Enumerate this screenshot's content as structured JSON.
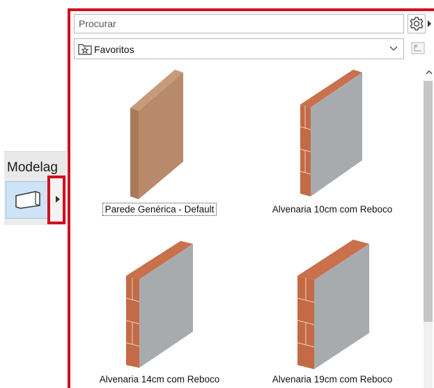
{
  "toolbox": {
    "tab_label": "Modelag",
    "tool_icon": "wall-tool-icon",
    "expand_icon": "expand-arrow-icon"
  },
  "panel": {
    "search_placeholder": "Procurar",
    "settings_icon": "gear-icon",
    "folder_selected": "Favoritos",
    "folder_icon": "star-folder-icon",
    "up_icon": "folder-up-icon",
    "items": [
      {
        "label": "Parede Genérica - Default",
        "selected": true
      },
      {
        "label": "Alvenaria 10cm com Reboco",
        "selected": false
      },
      {
        "label": "Alvenaria 14cm com Reboco",
        "selected": false
      },
      {
        "label": "Alvenaria 19cm com Reboco",
        "selected": false
      }
    ]
  },
  "colors": {
    "highlight": "#d10f1f",
    "generic_wall": "#b8896a",
    "brick": "#c46a45",
    "plaster": "#a7abae"
  }
}
